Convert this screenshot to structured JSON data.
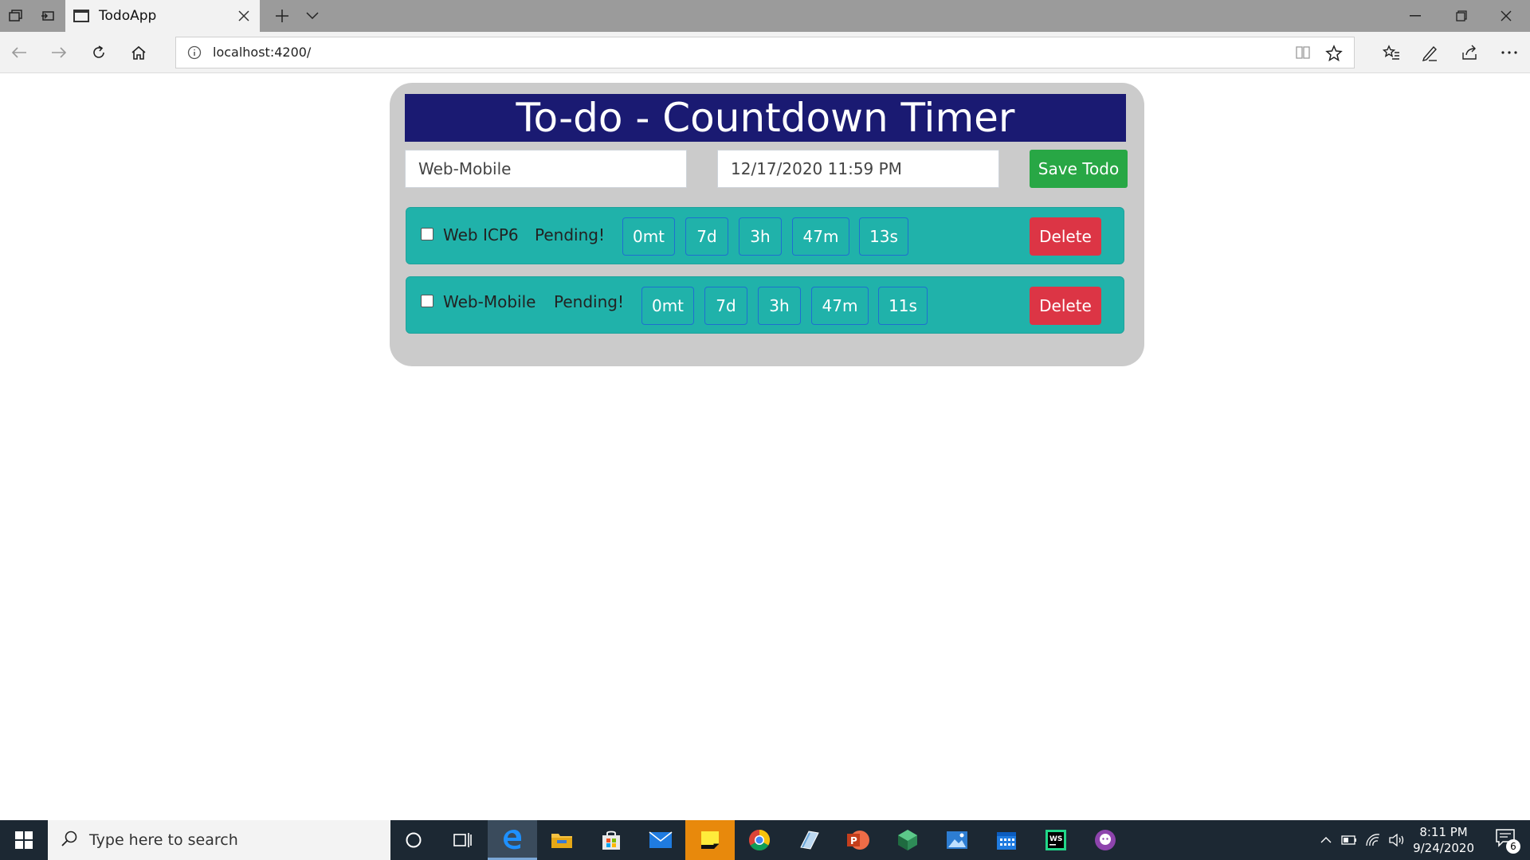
{
  "browser": {
    "tab_title": "TodoApp",
    "url": "localhost:4200/"
  },
  "app": {
    "title": "To-do - Countdown Timer",
    "name_input": {
      "value": "Web-Mobile"
    },
    "date_input": {
      "value": "12/17/2020 11:59 PM"
    },
    "save_label": "Save Todo",
    "todos": [
      {
        "name": "Web ICP6",
        "status": "Pending!",
        "months": "0mt",
        "days": "7d",
        "hours": "3h",
        "minutes": "47m",
        "seconds": "13s",
        "delete_label": "Delete",
        "checked": false
      },
      {
        "name": "Web-Mobile",
        "status": "Pending!",
        "months": "0mt",
        "days": "7d",
        "hours": "3h",
        "minutes": "47m",
        "seconds": "11s",
        "delete_label": "Delete",
        "checked": false
      }
    ]
  },
  "taskbar": {
    "search_placeholder": "Type here to search",
    "time": "8:11 PM",
    "date": "9/24/2020",
    "notification_count": "6"
  },
  "colors": {
    "header_bg": "#1a1a72",
    "row_bg": "#20b2aa",
    "save_btn": "#28a745",
    "delete_btn": "#dc3545",
    "card_bg": "#cbcbcb"
  }
}
